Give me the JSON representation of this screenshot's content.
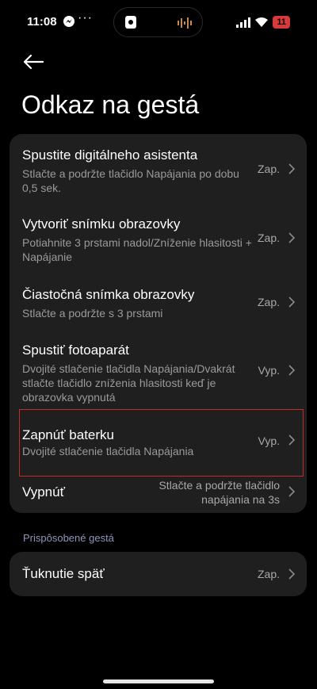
{
  "status_bar": {
    "time": "11:08",
    "dots": "···",
    "battery": "11",
    "icons": [
      "messenger-icon",
      "speaker-icon",
      "waveform-icon",
      "signal-icon",
      "wifi-icon",
      "battery-icon"
    ]
  },
  "header": {
    "back_icon": "arrow-left-icon",
    "title": "Odkaz na gestá"
  },
  "gestures": [
    {
      "title": "Spustite digitálneho asistenta",
      "subtitle": "Stlačte a podržte tlačidlo Napájania po dobu 0,5 sek.",
      "value": "Zap."
    },
    {
      "title": "Vytvoriť snímku obrazovky",
      "subtitle": "Potiahnite 3 prstami nadol/Zníženie hlasitosti + Napájanie",
      "value": "Zap."
    },
    {
      "title": "Čiastočná snímka obrazovky",
      "subtitle": "Stlačte a podržte s 3 prstami",
      "value": "Zap."
    },
    {
      "title": "Spustiť fotoaparát",
      "subtitle": "Dvojité stlačenie tlačidla Napájania/Dvakrát stlačte tlačidlo zníženia hlasitosti keď je obrazovka vypnutá",
      "value": "Vyp."
    },
    {
      "title": "Zapnúť baterku",
      "subtitle": "Dvojité stlačenie tlačidla Napájania",
      "value": "Vyp."
    },
    {
      "title": "Vypnúť",
      "subtitle": "",
      "value": "Stlačte a podržte tlačidlo napájania na 3s"
    }
  ],
  "custom_section": {
    "label": "Prispôsobené gestá",
    "items": [
      {
        "title": "Ťuknutie späť",
        "value": "Zap."
      }
    ]
  },
  "colors": {
    "background": "#000000",
    "card": "#1f1f1f",
    "highlight_border": "#c82828",
    "section_label": "#8f95b8",
    "battery": "#d63a3a"
  }
}
